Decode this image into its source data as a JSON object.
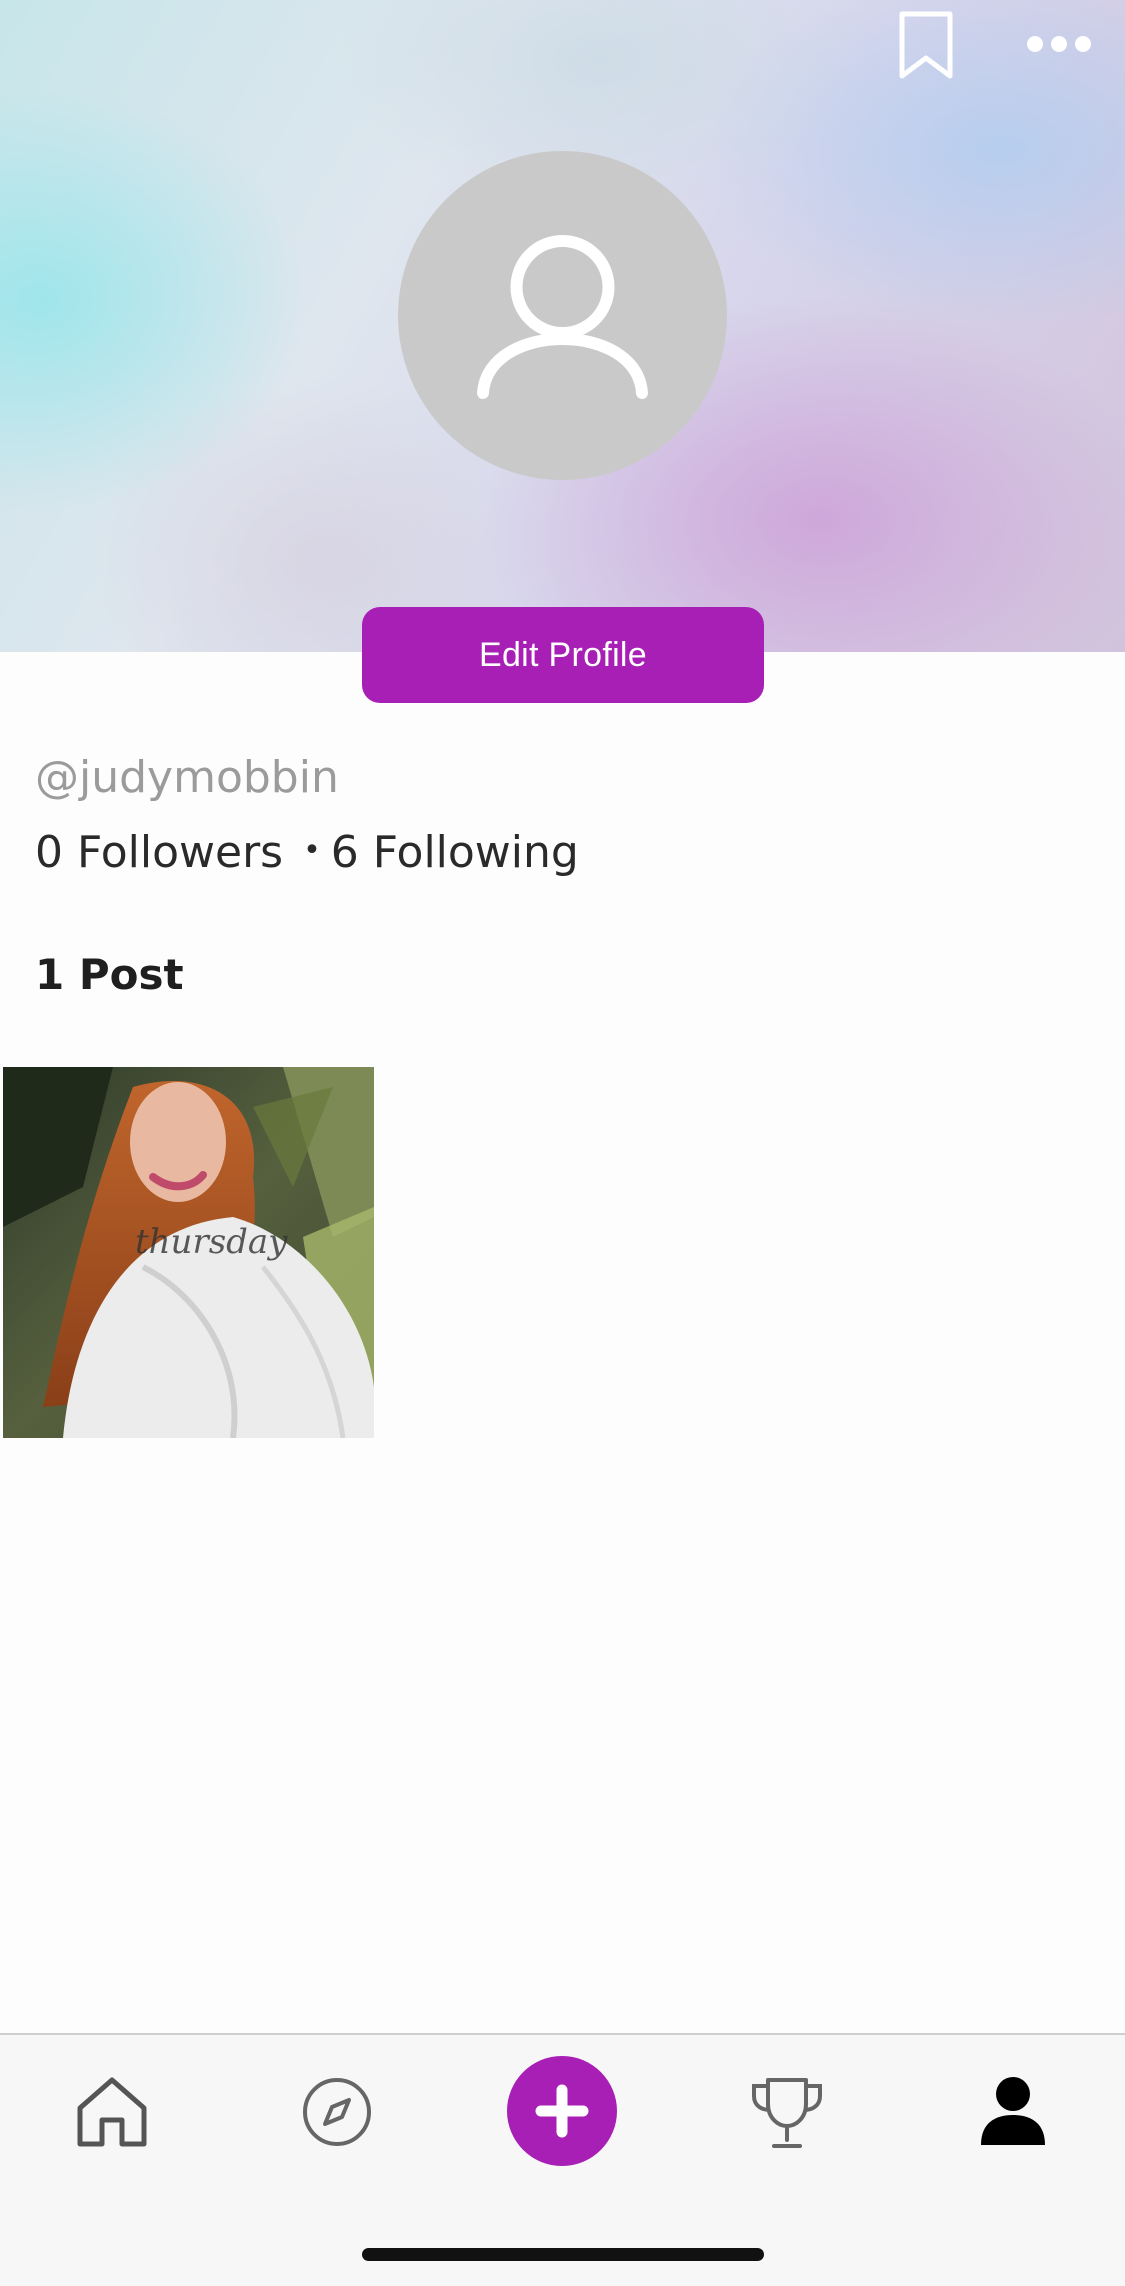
{
  "header": {
    "bookmark_icon": "bookmark-icon",
    "more_icon": "more-horizontal-icon"
  },
  "profile": {
    "avatar_icon": "user-avatar-placeholder-icon",
    "edit_button_label": "Edit Profile",
    "handle": "@judymobbin",
    "followers": "0 Followers",
    "separator": "•",
    "following": "6 Following",
    "posts_count": "1 Post"
  },
  "posts": [
    {
      "thumbnail_text": "thursday"
    }
  ],
  "bottom_nav": {
    "items": [
      {
        "icon": "home-icon"
      },
      {
        "icon": "compass-icon"
      },
      {
        "icon": "plus-icon"
      },
      {
        "icon": "trophy-icon"
      },
      {
        "icon": "person-icon"
      }
    ]
  },
  "colors": {
    "accent": "#a71fb5",
    "muted_text": "#9b9b9b"
  }
}
